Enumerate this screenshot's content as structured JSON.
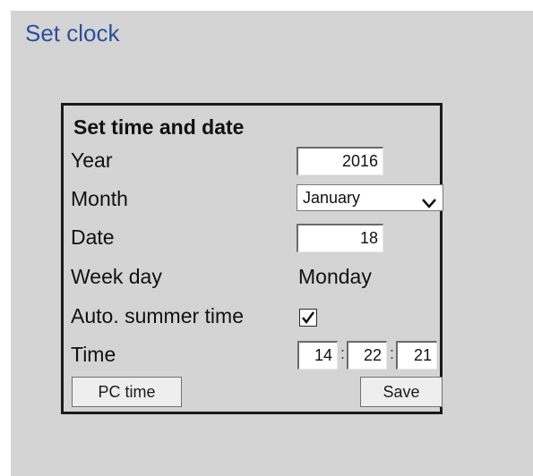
{
  "page": {
    "title": "Set clock"
  },
  "panel": {
    "heading": "Set time and date",
    "year": {
      "label": "Year",
      "value": "2016"
    },
    "month": {
      "label": "Month",
      "selected": "January",
      "chevron_icon": "chevron-down-icon"
    },
    "date": {
      "label": "Date",
      "value": "18"
    },
    "weekday": {
      "label": "Week day",
      "value": "Monday"
    },
    "summer_time": {
      "label": "Auto. summer time",
      "checked": true,
      "icon": "checkmark-icon"
    },
    "time": {
      "label": "Time",
      "hours": "14",
      "minutes": "22",
      "seconds": "21",
      "separator": ":"
    },
    "buttons": {
      "pc_time": "PC time",
      "save": "Save"
    }
  },
  "colors": {
    "title": "#2a4f9e",
    "panel_background": "#d4d4d4",
    "box_border": "#1a1a1a"
  }
}
